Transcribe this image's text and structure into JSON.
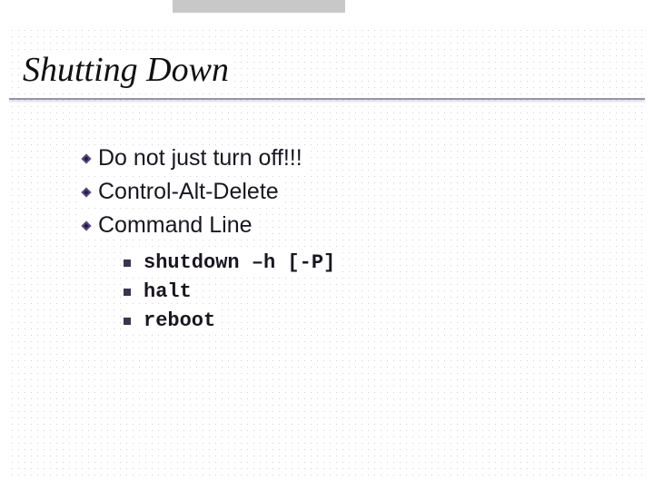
{
  "title": "Shutting Down",
  "bullets": {
    "main": [
      "Do not just turn off!!!",
      "Control-Alt-Delete",
      "Command Line"
    ],
    "sub": [
      "shutdown –h [-P]",
      "halt",
      "reboot"
    ]
  }
}
